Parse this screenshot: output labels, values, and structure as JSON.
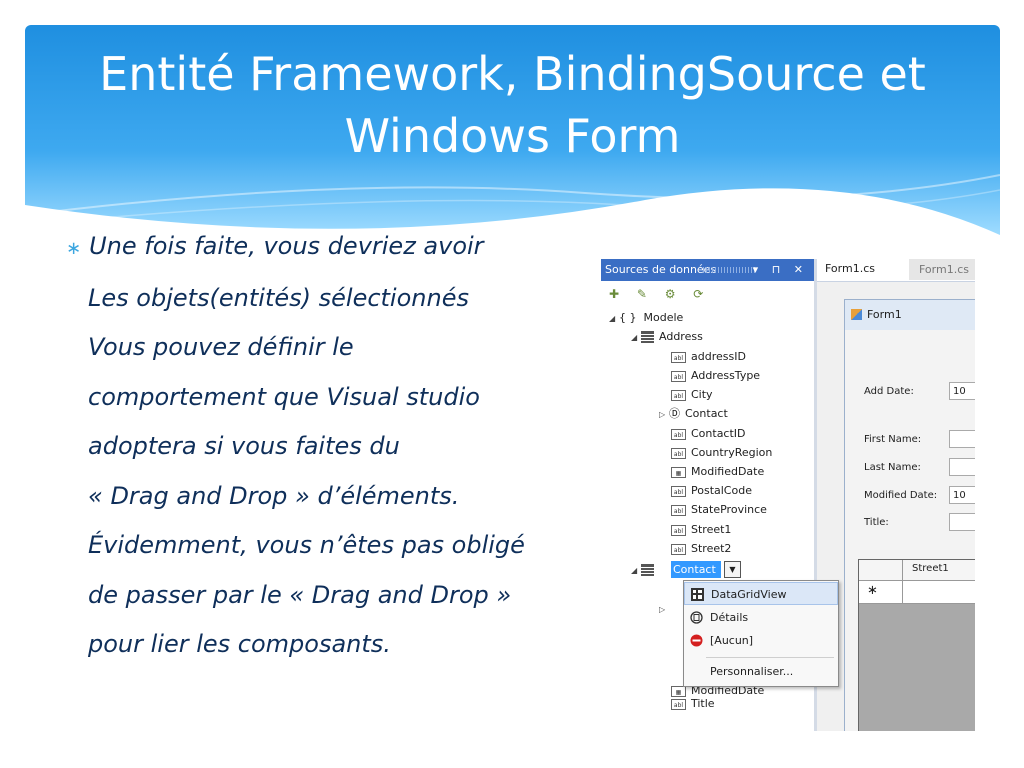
{
  "slide": {
    "title_line1": "Entité Framework, BindingSource et",
    "title_line2": "Windows Form",
    "body_lines": [
      "Une fois faite, vous devriez avoir",
      "Les objets(entités) sélectionnés",
      "Vous pouvez définir le",
      "comportement que Visual studio",
      "adoptera si vous faites du",
      "« Drag and Drop » d’éléments.",
      "Évidemment, vous n’êtes pas obligé",
      "de passer par le « Drag and Drop »",
      "pour lier les composants."
    ],
    "bullet_glyph": "∗"
  },
  "data_sources": {
    "panel_title": "Sources de données",
    "panel_controls": "▾ ⊓ ✕",
    "toolbar_icons": [
      "add-data-source-icon",
      "edit-dataset-icon",
      "configure-icon",
      "refresh-icon"
    ],
    "toolbar_glyphs": "✚ ✎ ⚙ ⟳",
    "tree": {
      "root": "Modele",
      "address": {
        "label": "Address",
        "fields": [
          "addressID",
          "AddressType",
          "City",
          "Contact",
          "ContactID",
          "CountryRegion",
          "ModifiedDate",
          "PostalCode",
          "StateProvince",
          "Street1",
          "Street2"
        ]
      },
      "contact": {
        "label": "Contact",
        "trailing_fields": [
          "ModifiedDate",
          "Title"
        ]
      }
    },
    "dropdown_menu": {
      "items": [
        "DataGridView",
        "Détails",
        "[Aucun]",
        "Personnaliser..."
      ]
    }
  },
  "designer": {
    "tabs": [
      "Form1.cs",
      "Form1.cs"
    ],
    "form_title": "Form1",
    "labels": [
      "Add Date:",
      "First Name:",
      "Last Name:",
      "Modified Date:",
      "Title:"
    ],
    "add_date_value": "10",
    "modified_date_value": "10",
    "grid_column": "Street1",
    "new_row_glyph": "∗"
  },
  "colors": {
    "header_blue": "#1f8fe0",
    "header_light": "#7fd0ff",
    "body_text": "#0f2f5a",
    "panel_title_bg": "#3a6ec4",
    "menu_highlight": "#dbe7f7"
  }
}
